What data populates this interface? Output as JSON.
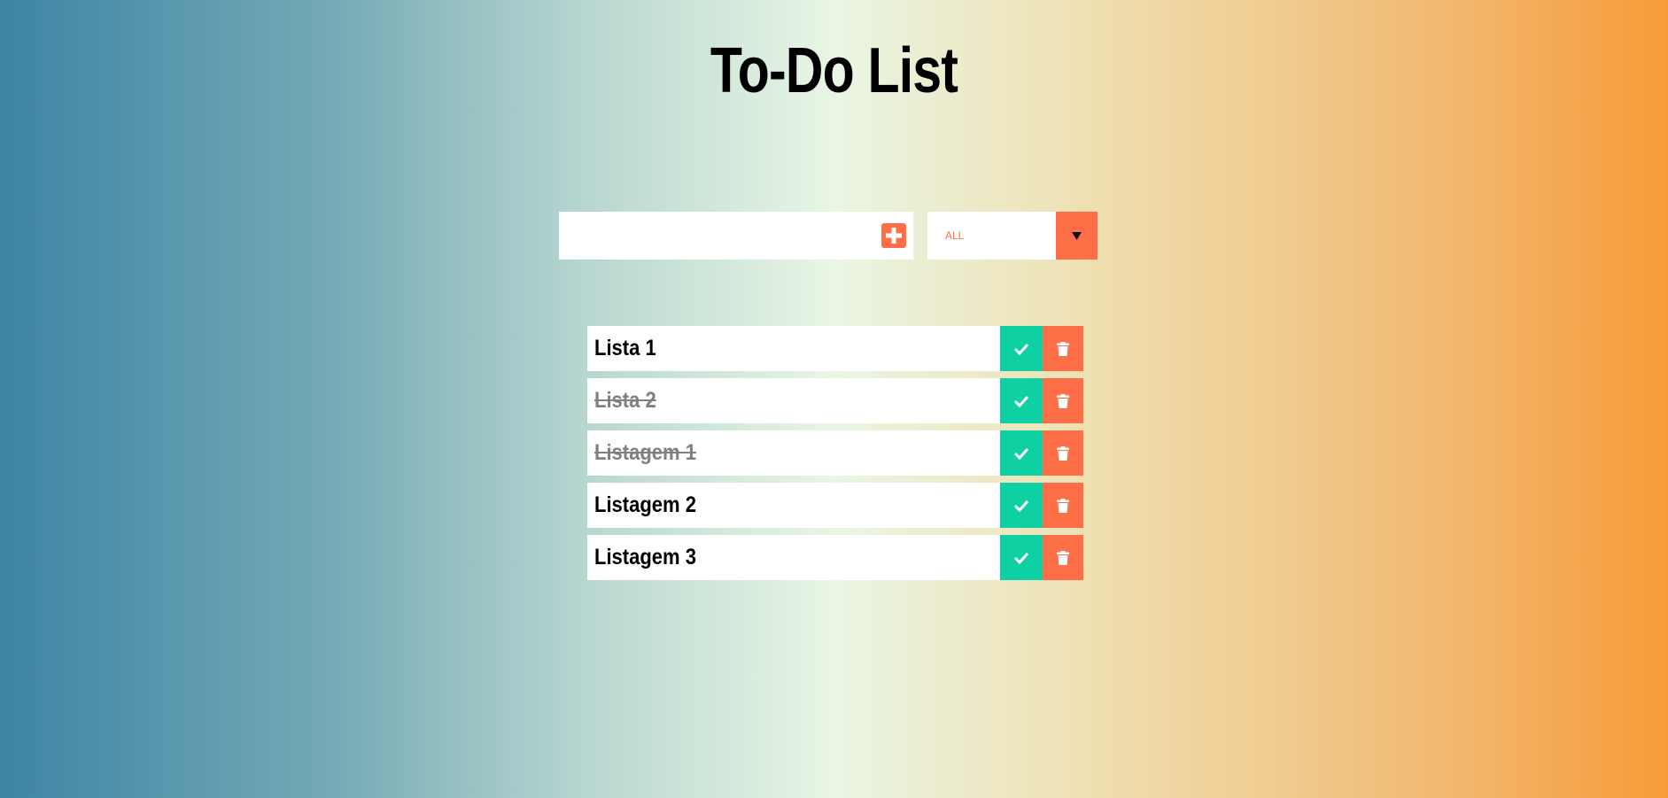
{
  "header": {
    "title": "To-Do List"
  },
  "form": {
    "input_value": "",
    "input_placeholder": "",
    "add_icon": "plus-square-icon",
    "filter_selected": "ALL",
    "filter_icon": "caret-down-icon"
  },
  "todos": [
    {
      "text": "Lista 1",
      "completed": false
    },
    {
      "text": "Lista 2",
      "completed": true
    },
    {
      "text": "Listagem 1",
      "completed": true
    },
    {
      "text": "Listagem 2",
      "completed": false
    },
    {
      "text": "Listagem 3",
      "completed": false
    }
  ],
  "item_icons": {
    "complete": "check-icon",
    "delete": "trash-icon"
  },
  "colors": {
    "accent": "#ff6f47",
    "complete": "#0fd0a2",
    "completed_text": "#808080"
  }
}
